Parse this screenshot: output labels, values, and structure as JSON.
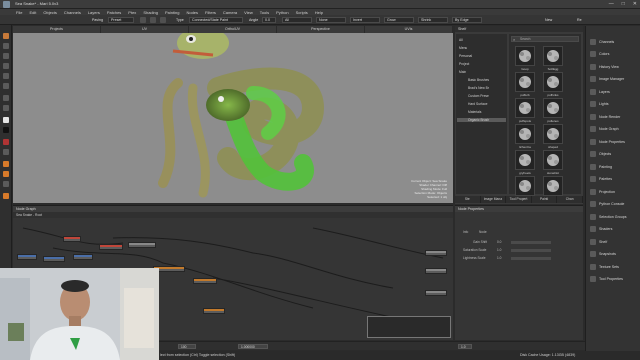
{
  "window": {
    "title": "Sea Snake* - Mari 5.0v3",
    "controls": [
      "—",
      "□",
      "✕"
    ]
  },
  "menu": [
    "File",
    "Edit",
    "Objects",
    "Channels",
    "Layers",
    "Patches",
    "Ptex",
    "Shading",
    "Painting",
    "Nodes",
    "Filters",
    "Camera",
    "View",
    "Tools",
    "Python",
    "Scripts",
    "Help"
  ],
  "toolbar": {
    "mode_label": "Paving",
    "mode_value": "Preset",
    "type_label": "Type",
    "type_value": "Connected/State Paint",
    "angle_label": "Angle",
    "angle_value": "0.0",
    "all_label": "All",
    "none_label": "None",
    "invert_label": "Invert",
    "grow_label": "Grow",
    "shrink_label": "Shrink",
    "by_edge_value": "By Edge",
    "new_label": "New",
    "re_label": "Re"
  },
  "viewport_tabs": [
    "Projects",
    "UV",
    "Ortho/UV",
    "Perspective",
    "UVIs"
  ],
  "viewport_info": {
    "lines": [
      "Current Object: Sea Snake",
      "Shader Channel: Diff",
      "Shading Mode: Full",
      "Selection Mode: Objects",
      "Selected: 1 obj"
    ]
  },
  "shelf": {
    "title": "Shelf",
    "search_placeholder": "Search",
    "tree": [
      "All",
      "Menu",
      "Personal",
      "Project",
      "Main",
      "Basic Brushes",
      "Brad's New Br",
      "Custom Prese",
      "Hard Surface",
      "Materials",
      "Organic Brush"
    ],
    "selected_tree_item": "Organic Brush",
    "brushes": [
      "Goop",
      "SoftEgg",
      "pufferb",
      "puffsnks",
      "puffspots",
      "pollenes",
      "lichenCa",
      "shaped",
      "gryFeels",
      "stoneDot",
      "kerneRtc",
      "stipplere"
    ],
    "tabs": [
      "Ste",
      "Image Mana",
      "Tool Propert",
      "Painti",
      "Chan"
    ]
  },
  "right_panel": {
    "items": [
      {
        "icon": "channels-icon",
        "label": "Channels"
      },
      {
        "icon": "colors-icon",
        "label": "Colors"
      },
      {
        "icon": "history-icon",
        "label": "History View"
      },
      {
        "icon": "image-manager-icon",
        "label": "Image Manager"
      },
      {
        "icon": "layers-icon",
        "label": "Layers"
      },
      {
        "icon": "lights-icon",
        "label": "Lights"
      },
      {
        "icon": "node-render-icon",
        "label": "Node Render"
      },
      {
        "icon": "node-graph-icon",
        "label": "Node Graph"
      },
      {
        "icon": "node-properties-icon",
        "label": "Node Properties"
      },
      {
        "icon": "objects-icon",
        "label": "Objects"
      },
      {
        "icon": "painting-icon",
        "label": "Painting"
      },
      {
        "icon": "palettes-icon",
        "label": "Palettes"
      },
      {
        "icon": "projection-icon",
        "label": "Projection"
      },
      {
        "icon": "python-console-icon",
        "label": "Python Console"
      },
      {
        "icon": "selection-groups-icon",
        "label": "Selection Groups"
      },
      {
        "icon": "shaders-icon",
        "label": "Shaders"
      },
      {
        "icon": "shelf-icon",
        "label": "Shelf"
      },
      {
        "icon": "snapshots-icon",
        "label": "Snapshots"
      },
      {
        "icon": "texture-sets-icon",
        "label": "Texture Sets"
      },
      {
        "icon": "tool-properties-icon",
        "label": "Tool Properties"
      }
    ]
  },
  "node_graph": {
    "title": "Node Graph",
    "breadcrumb": "Sea Snake - Root"
  },
  "node_properties": {
    "title": "Node Properties",
    "tabs": [
      "Info",
      "Node"
    ],
    "rows": [
      "Gain Shift",
      "Saturation Scale",
      "Lightness Scale"
    ],
    "values": [
      "0.0",
      "1.0",
      "1.0"
    ]
  },
  "status": {
    "zoom_value": "100",
    "frame_value": "1.000000",
    "hint_text": "lect from selection (Ctrl)   Toggle selection (Shift)",
    "cache_text": "Disk Cache Usage: 1.13GB (4839)",
    "fps_value": "1.0"
  }
}
